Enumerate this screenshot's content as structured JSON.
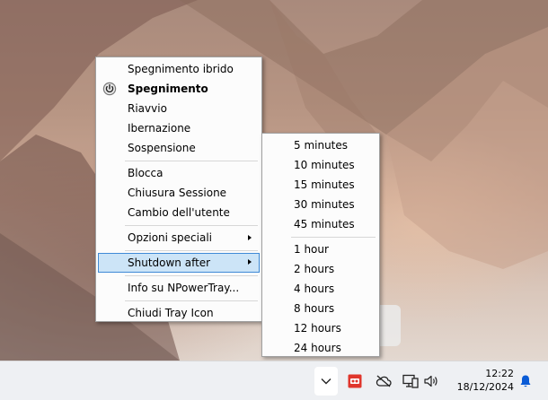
{
  "main_menu": {
    "items": [
      {
        "label": "Spegnimento ibrido"
      },
      {
        "label": "Spegnimento"
      },
      {
        "label": "Riavvio"
      },
      {
        "label": "Ibernazione"
      },
      {
        "label": "Sospensione"
      },
      {
        "label": "Blocca"
      },
      {
        "label": "Chiusura Sessione"
      },
      {
        "label": "Cambio dell'utente"
      },
      {
        "label": "Opzioni speciali"
      },
      {
        "label": "Shutdown after"
      },
      {
        "label": "Info su NPowerTray..."
      },
      {
        "label": "Chiudi Tray Icon"
      }
    ],
    "default_item_icon": "power-icon",
    "submenu_icon": "chevron-right-icon"
  },
  "shutdown_submenu": {
    "items": [
      {
        "label": "5 minutes"
      },
      {
        "label": "10 minutes"
      },
      {
        "label": "15 minutes"
      },
      {
        "label": "30 minutes"
      },
      {
        "label": "45 minutes"
      },
      {
        "label": "1 hour"
      },
      {
        "label": "2 hours"
      },
      {
        "label": "4 hours"
      },
      {
        "label": "8 hours"
      },
      {
        "label": "12 hours"
      },
      {
        "label": "24 hours"
      }
    ]
  },
  "taskbar": {
    "time": "12:22",
    "date": "18/12/2024",
    "icons": [
      "chevron-up-icon",
      "app-tray-icon",
      "cloud-off-icon",
      "network-icon",
      "volume-icon",
      "bell-icon"
    ]
  },
  "colors": {
    "highlight_bg": "#cce4f7",
    "highlight_border": "#3f8ad6",
    "bell": "#0a5bd6",
    "tray_app_red": "#e0362c"
  }
}
